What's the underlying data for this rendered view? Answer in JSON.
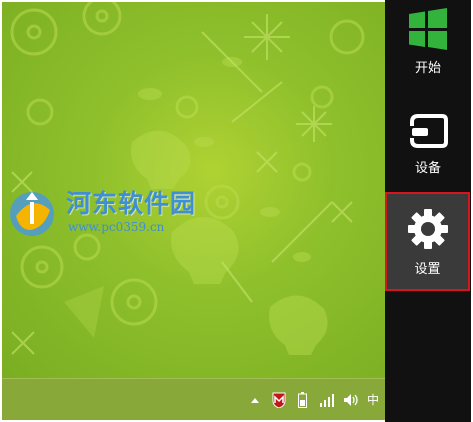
{
  "watermark": {
    "title": "河东软件园",
    "url": "www.pc0359.cn"
  },
  "charms": [
    {
      "label": "开始",
      "icon": "windows-logo-icon"
    },
    {
      "label": "设备",
      "icon": "devices-icon"
    },
    {
      "label": "设置",
      "icon": "gear-icon",
      "highlighted": true
    }
  ],
  "taskbar": {
    "tray_icons": [
      "show-hidden-icons-chevron-icon",
      "mcafee-icon",
      "battery-icon",
      "network-signal-icon",
      "volume-icon"
    ],
    "ime_indicator": "中"
  },
  "colors": {
    "wallpaper": "#8fc02c",
    "charms_bg": "#111111",
    "start_tile": "#33b33b",
    "highlight_border": "#d6161e",
    "watermark_text": "#3f8fd2"
  }
}
